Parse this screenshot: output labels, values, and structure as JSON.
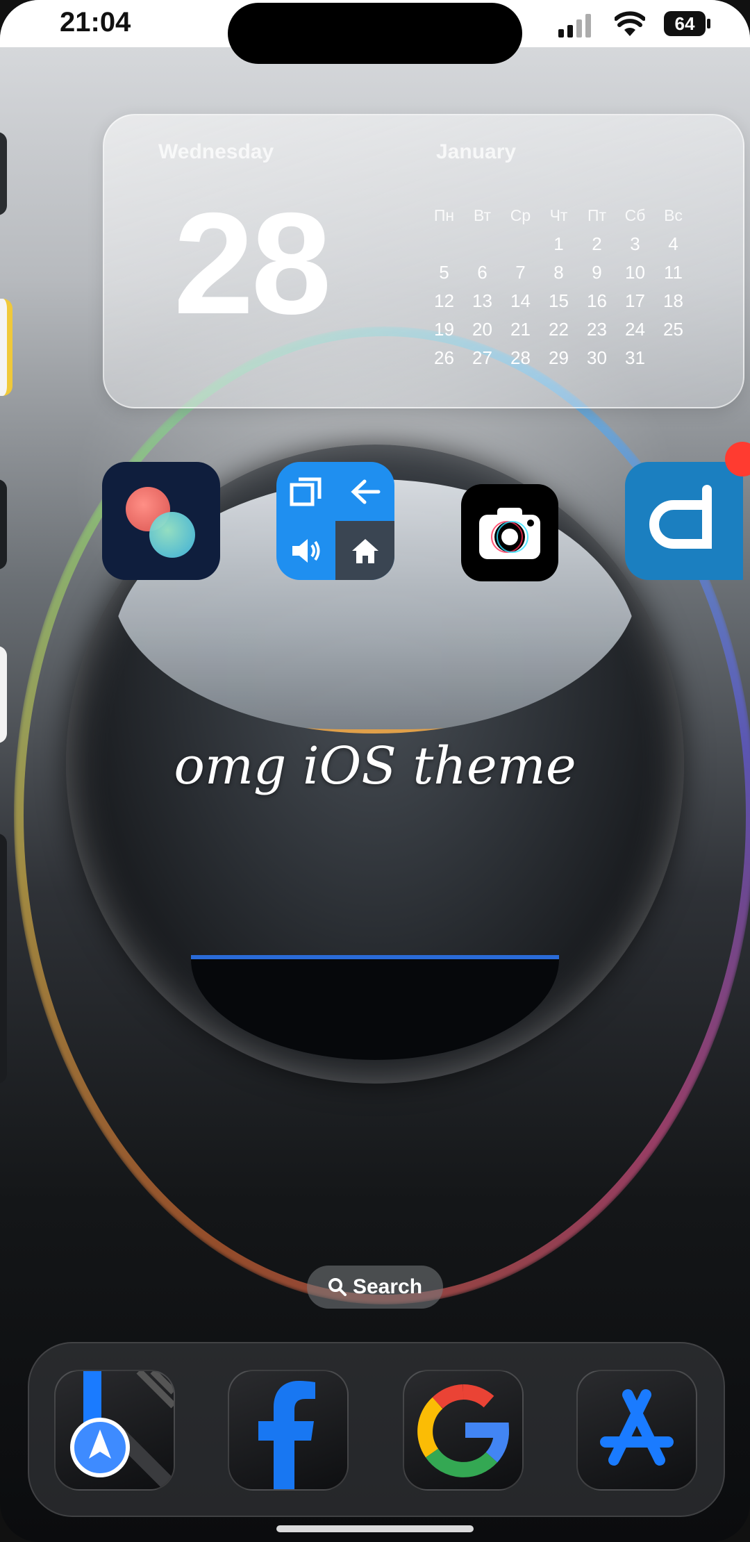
{
  "status_bar": {
    "time": "21:04",
    "battery": "64"
  },
  "calendar_widget": {
    "weekday": "Wednesday",
    "month": "January",
    "day": "28",
    "weekday_headers": [
      "Пн",
      "Вт",
      "Ср",
      "Чт",
      "Пт",
      "Сб",
      "Вс"
    ],
    "rows": [
      [
        "",
        "",
        "",
        "1",
        "2",
        "3",
        "4"
      ],
      [
        "5",
        "6",
        "7",
        "8",
        "9",
        "10",
        "11"
      ],
      [
        "12",
        "13",
        "14",
        "15",
        "16",
        "17",
        "18"
      ],
      [
        "19",
        "20",
        "21",
        "22",
        "23",
        "24",
        "25"
      ],
      [
        "26",
        "27",
        "28",
        "29",
        "30",
        "31",
        ""
      ]
    ],
    "today": "28"
  },
  "home_text": "omg iOS theme",
  "search": {
    "label": "Search"
  },
  "apps": [
    {
      "icon": "color-orbs-app-icon"
    },
    {
      "icon": "assistive-controls-app-icon"
    },
    {
      "icon": "camera-app-icon"
    },
    {
      "icon": "d-app-icon"
    }
  ],
  "dock": [
    {
      "icon": "maps-icon"
    },
    {
      "icon": "facebook-icon"
    },
    {
      "icon": "google-icon"
    },
    {
      "icon": "app-store-icon"
    }
  ],
  "colors": {
    "assist_blue": "#1f8ff0",
    "badge_red": "#ff3b30",
    "dock_blue": "#1a7bff"
  }
}
